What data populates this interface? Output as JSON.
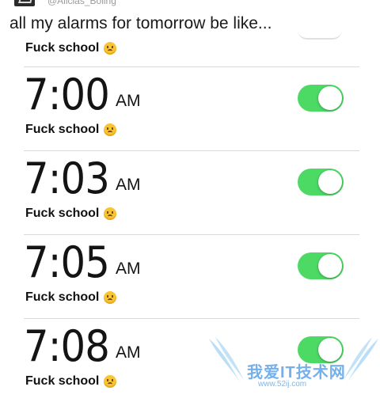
{
  "post": {
    "handle": "@Alicias_Boling",
    "caption": "all my alarms for tomorrow be like..."
  },
  "alarms": [
    {
      "time": "",
      "ampm": "",
      "label": "Fuck school",
      "enabled": true,
      "partial": true
    },
    {
      "time": "7:00",
      "ampm": "AM",
      "label": "Fuck school",
      "enabled": true
    },
    {
      "time": "7:03",
      "ampm": "AM",
      "label": "Fuck school",
      "enabled": true
    },
    {
      "time": "7:05",
      "ampm": "AM",
      "label": "Fuck school",
      "enabled": true
    },
    {
      "time": "7:08",
      "ampm": "AM",
      "label": "Fuck school",
      "enabled": true
    }
  ],
  "icons": {
    "label_emoji": "upside-down-face-icon"
  },
  "colors": {
    "toggle_on": "#4cd964",
    "watermark": "#4696e6"
  },
  "watermark": {
    "text": "我爱IT技术网",
    "url": "www.52ij.com"
  }
}
